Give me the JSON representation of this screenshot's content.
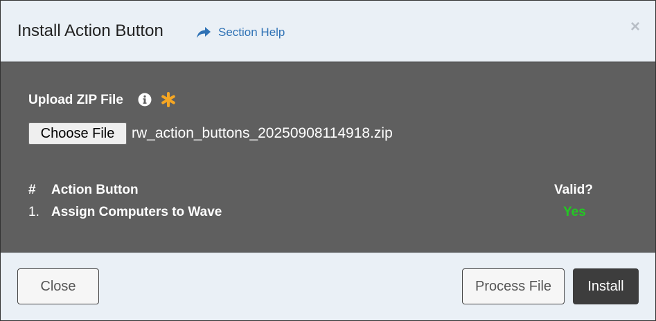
{
  "dialog": {
    "title": "Install Action Button",
    "help_label": "Section Help",
    "close_symbol": "×"
  },
  "upload": {
    "label": "Upload ZIP File",
    "info_icon": "info-circle-icon",
    "required_icon": "asterisk-icon",
    "required_color": "#f5a623",
    "choose_button": "Choose File",
    "filename": "rw_action_buttons_20250908114918.zip"
  },
  "table": {
    "headers": {
      "number": "#",
      "name": "Action Button",
      "valid": "Valid?"
    },
    "rows": [
      {
        "number": "1.",
        "name": "Assign Computers to Wave",
        "valid": "Yes",
        "valid_color": "#22c922"
      }
    ]
  },
  "footer": {
    "close_label": "Close",
    "process_label": "Process File",
    "install_label": "Install"
  }
}
